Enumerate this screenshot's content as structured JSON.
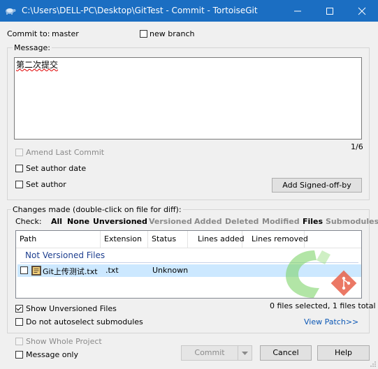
{
  "window": {
    "title": "C:\\Users\\DELL-PC\\Desktop\\GitTest - Commit - TortoiseGit",
    "title_color": "#1b6ec2"
  },
  "commit_to": {
    "label": "Commit to:",
    "branch": "master"
  },
  "new_branch": {
    "label": "new branch",
    "checked": false
  },
  "message": {
    "group_label": "Message:",
    "text": "第二次提交",
    "counter": "1/6"
  },
  "options": {
    "amend_last_commit": {
      "label": "Amend Last Commit",
      "checked": false,
      "enabled": false
    },
    "set_author_date": {
      "label": "Set author date",
      "checked": false
    },
    "set_author": {
      "label": "Set author",
      "checked": false
    },
    "add_signed_off_by": "Add Signed-off-by"
  },
  "changes": {
    "group_label": "Changes made (double-click on file for diff):",
    "check_label": "Check:",
    "filters": [
      {
        "label": "All",
        "enabled": true
      },
      {
        "label": "None",
        "enabled": true
      },
      {
        "label": "Unversioned",
        "enabled": true
      },
      {
        "label": "Versioned",
        "enabled": false
      },
      {
        "label": "Added",
        "enabled": false
      },
      {
        "label": "Deleted",
        "enabled": false
      },
      {
        "label": "Modified",
        "enabled": false
      },
      {
        "label": "Files",
        "enabled": true
      },
      {
        "label": "Submodules",
        "enabled": false
      }
    ],
    "columns": [
      "Path",
      "Extension",
      "Status",
      "Lines added",
      "Lines removed"
    ],
    "section_header": "Not Versioned Files",
    "rows": [
      {
        "path": "Git上传测试.txt",
        "extension": ".txt",
        "status": "Unknown",
        "lines_added": "",
        "lines_removed": "",
        "checked": false,
        "selected": true
      }
    ],
    "show_unversioned": {
      "label": "Show Unversioned Files",
      "checked": true
    },
    "do_not_autoselect": {
      "label": "Do not autoselect submodules",
      "checked": false
    },
    "summary": "0 files selected, 1 files total",
    "view_patch": "View Patch>>"
  },
  "bottom": {
    "show_whole_project": {
      "label": "Show Whole Project",
      "checked": false,
      "enabled": false
    },
    "message_only": {
      "label": "Message only",
      "checked": false
    }
  },
  "buttons": {
    "commit": "Commit",
    "cancel": "Cancel",
    "help": "Help"
  },
  "icons": [
    "tortoise-app-icon",
    "minimize-icon",
    "maximize-icon",
    "close-icon",
    "text-file-icon",
    "dropdown-arrow-icon",
    "watermark-logo-icon"
  ]
}
